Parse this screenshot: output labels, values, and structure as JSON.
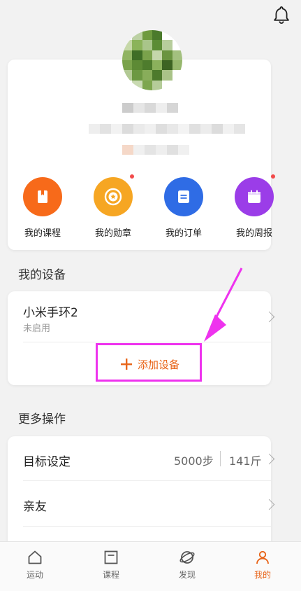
{
  "header": {
    "bell_icon": "bell-icon"
  },
  "profile": {
    "quick_links": [
      {
        "label": "我的课程",
        "icon": "book-icon",
        "color": "#f76a1a",
        "badge": false
      },
      {
        "label": "我的勋章",
        "icon": "medal-icon",
        "color": "#f6a623",
        "badge": true
      },
      {
        "label": "我的订单",
        "icon": "order-icon",
        "color": "#2f6ce5",
        "badge": false
      },
      {
        "label": "我的周报",
        "icon": "calendar-icon",
        "color": "#9b3de8",
        "badge": true
      }
    ]
  },
  "devices": {
    "title": "我的设备",
    "items": [
      {
        "name": "小米手环2",
        "status": "未启用"
      }
    ],
    "add_label": "添加设备"
  },
  "more": {
    "title": "更多操作",
    "goal": {
      "label": "目标设定",
      "steps": "5000步",
      "weight": "141斤"
    },
    "friends": {
      "label": "亲友"
    }
  },
  "tabbar": {
    "tabs": [
      {
        "label": "运动",
        "icon": "home-icon",
        "active": false
      },
      {
        "label": "课程",
        "icon": "course-icon",
        "active": false
      },
      {
        "label": "发现",
        "icon": "planet-icon",
        "active": false
      },
      {
        "label": "我的",
        "icon": "profile-icon",
        "active": true
      }
    ]
  },
  "colors": {
    "accent": "#e8651a",
    "annotation": "#ee33ee"
  }
}
